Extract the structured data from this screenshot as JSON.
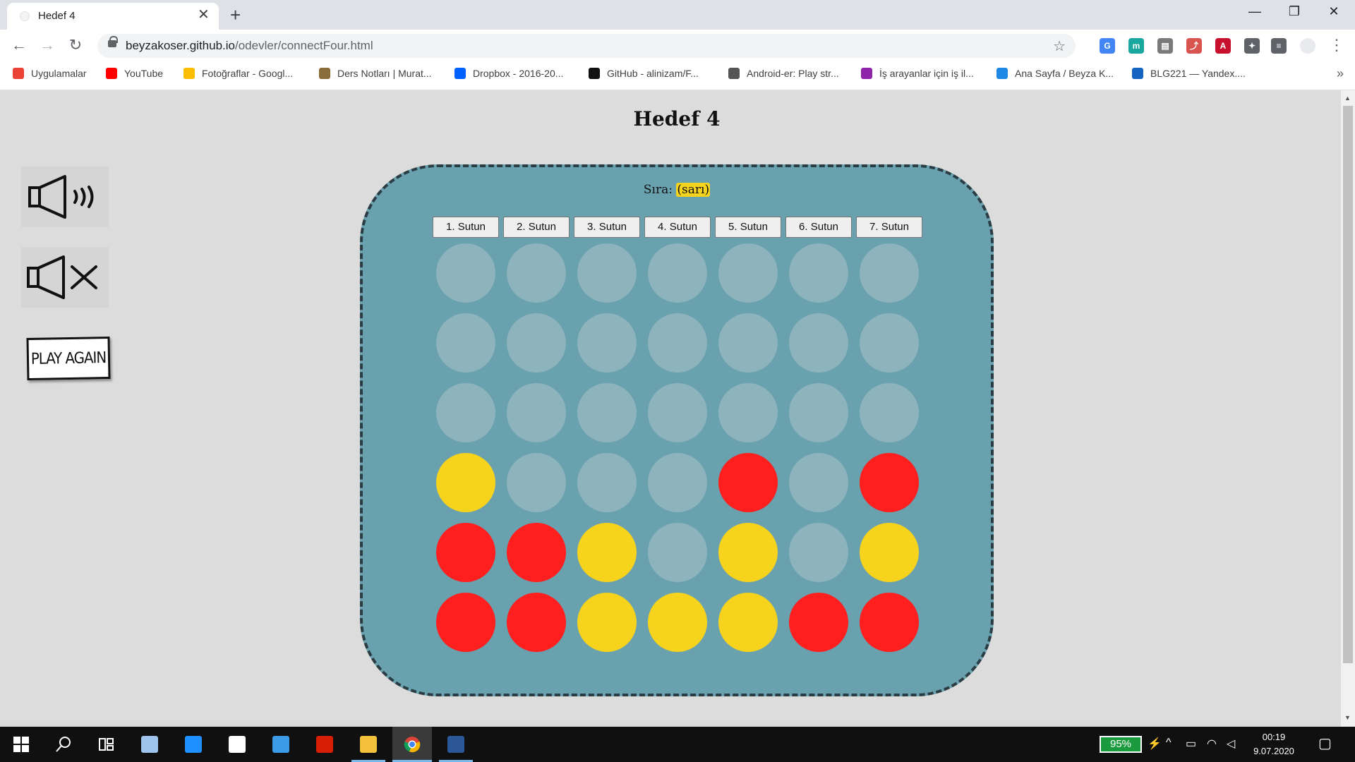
{
  "browser": {
    "tab_title": "Hedef 4",
    "new_tab": "+",
    "close_tab": "✕",
    "window_controls": {
      "minimize": "—",
      "maximize": "❐",
      "close": "✕"
    },
    "nav": {
      "back": "←",
      "forward": "→",
      "reload": "↻"
    },
    "url_host": "beyzakoser.github.io",
    "url_path": "/odevler/connectFour.html",
    "bookmark_star": "☆",
    "menu": "⋮",
    "extensions": [
      {
        "name": "translate-extension-icon",
        "label": "G",
        "color": "#4285f4"
      },
      {
        "name": "m-extension-icon",
        "label": "m",
        "color": "#1aa7a0"
      },
      {
        "name": "stack-extension-icon",
        "label": "▤",
        "color": "#7a7a7a"
      },
      {
        "name": "pdf-extension-icon",
        "label": "⤴",
        "color": "#d9544f"
      },
      {
        "name": "acrobat-extension-icon",
        "label": "A",
        "color": "#c8102e"
      },
      {
        "name": "puzzle-extension-icon",
        "label": "✦",
        "color": "#5f6368"
      },
      {
        "name": "media-control-icon",
        "label": "≡",
        "color": "#5f6368"
      }
    ]
  },
  "bookmarks": [
    {
      "label": "Uygulamalar",
      "icon": "apps-grid-icon",
      "color": "#ea4335"
    },
    {
      "label": "YouTube",
      "icon": "youtube-icon",
      "color": "#ff0000"
    },
    {
      "label": "Fotoğraflar - Googl...",
      "icon": "photos-icon",
      "color": "#fbbc04"
    },
    {
      "label": "Ders Notları | Murat...",
      "icon": "person-icon",
      "color": "#8a6d3b"
    },
    {
      "label": "Dropbox - 2016-20...",
      "icon": "dropbox-icon",
      "color": "#0061fe"
    },
    {
      "label": "GitHub - alinizam/F...",
      "icon": "github-icon",
      "color": "#111111"
    },
    {
      "label": "Android-er: Play str...",
      "icon": "android-icon",
      "color": "#555555"
    },
    {
      "label": "İş arayanlar için iş il...",
      "icon": "kariyer-icon",
      "color": "#8e24aa"
    },
    {
      "label": "Ana Sayfa / Beyza K...",
      "icon": "bookmark-page-icon",
      "color": "#1e88e5"
    },
    {
      "label": "BLG221 — Yandex....",
      "icon": "yandex-disk-icon",
      "color": "#1565c0"
    }
  ],
  "bookmarks_more": "»",
  "page": {
    "title": "Hedef 4",
    "turn_label": "Sıra:",
    "turn_value": "(sarı)",
    "play_again": "PLAY AGAIN",
    "columns": [
      "1. Sutun",
      "2. Sutun",
      "3. Sutun",
      "4. Sutun",
      "5. Sutun",
      "6. Sutun",
      "7. Sutun"
    ],
    "board": [
      [
        "e",
        "e",
        "e",
        "e",
        "e",
        "e",
        "e"
      ],
      [
        "e",
        "e",
        "e",
        "e",
        "e",
        "e",
        "e"
      ],
      [
        "e",
        "e",
        "e",
        "e",
        "e",
        "e",
        "e"
      ],
      [
        "y",
        "e",
        "e",
        "e",
        "r",
        "e",
        "r"
      ],
      [
        "r",
        "r",
        "y",
        "e",
        "y",
        "e",
        "y"
      ],
      [
        "r",
        "r",
        "y",
        "y",
        "y",
        "r",
        "r"
      ]
    ],
    "colors": {
      "empty": "#8db3bc",
      "red": "#ff1f1f",
      "yellow": "#f6d31c",
      "board": "#69a1ae"
    }
  },
  "taskbar": {
    "apps": [
      "start-icon",
      "search-icon",
      "task-view-icon",
      "3d-viewer-icon",
      "edge-icon",
      "store-icon",
      "mail-icon",
      "acrobat-icon",
      "file-explorer-icon",
      "chrome-icon",
      "word-icon"
    ],
    "battery": "95%",
    "time": "00:19",
    "date": "9.07.2020"
  }
}
